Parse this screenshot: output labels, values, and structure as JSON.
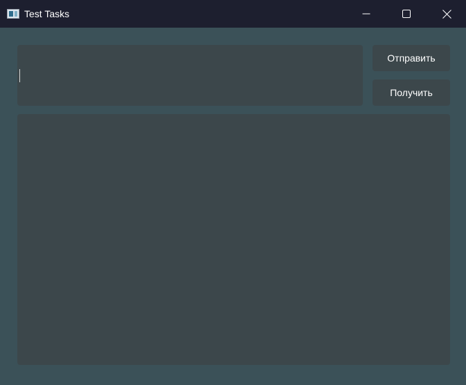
{
  "window": {
    "title": "Test Tasks",
    "icon": "app-window-icon",
    "controls": {
      "minimize": "minimize-icon",
      "maximize": "maximize-icon",
      "close": "close-icon"
    }
  },
  "editor": {
    "value": "",
    "placeholder": ""
  },
  "buttons": {
    "send_label": "Отправить",
    "get_label": "Получить"
  },
  "output": {
    "value": ""
  },
  "colors": {
    "titlebar": "#1d1f2f",
    "window_background": "#3b5158",
    "panel_background": "#3c474b",
    "text": "#ffffff"
  }
}
